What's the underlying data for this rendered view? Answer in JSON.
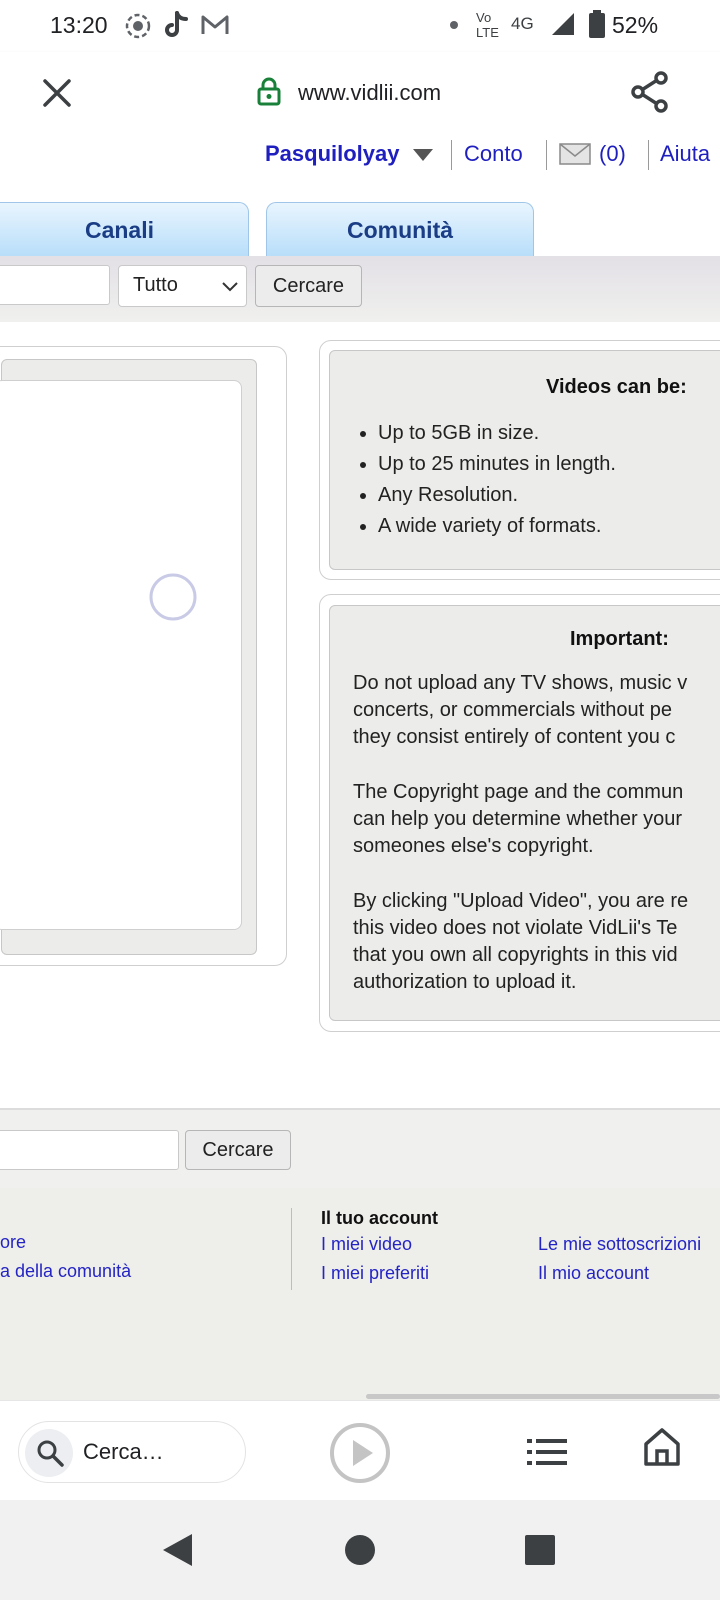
{
  "status_bar": {
    "time": "13:20",
    "network": "4G",
    "volte": "Vo LTE",
    "battery": "52%",
    "icons": [
      "record-icon",
      "tiktok-icon",
      "gmail-icon",
      "dot-icon",
      "signal-icon",
      "battery-icon"
    ]
  },
  "browser": {
    "url": "www.vidlii.com",
    "close_icon": "close-icon",
    "share_icon": "share-icon",
    "lock_icon": "lock-icon",
    "search_placeholder": "Cerca…"
  },
  "header": {
    "username": "Pasquilolyay",
    "account_link": "Conto",
    "inbox_count": "(0)",
    "help_link": "Aiuta"
  },
  "tabs": [
    {
      "label": "Canali"
    },
    {
      "label": "Comunità"
    }
  ],
  "search": {
    "category_selected": "Tutto",
    "button": "Cercare"
  },
  "info_box": {
    "title": "Videos can be:",
    "items": [
      "Up to 5GB in size.",
      "Up to 25 minutes in length.",
      "Any Resolution.",
      "A wide variety of formats."
    ]
  },
  "important_box": {
    "title": "Important:",
    "p1": [
      "Do not upload any TV shows, music v",
      "concerts, or commercials without pe",
      "they consist entirely of content you c"
    ],
    "p2": [
      "The Copyright page and the commun",
      "can help you determine whether your",
      "someones else's copyright."
    ],
    "p3": [
      "By clicking \"Upload Video\", you are re",
      "this video does not violate VidLii's Te",
      "that you own all copyrights in this vid",
      "authorization to upload it."
    ]
  },
  "footer_search": {
    "button": "Cercare"
  },
  "footer": {
    "left_links": [
      "ore",
      "a della comunità"
    ],
    "account_heading": "Il tuo account",
    "col2_links": [
      "I miei video",
      "I miei preferiti"
    ],
    "col3_links": [
      "Le mie sottoscrizioni",
      "Il mio account"
    ]
  },
  "colors": {
    "link": "#1f1fbf",
    "tab_text": "#1a3d85",
    "lock_green": "#188038"
  }
}
